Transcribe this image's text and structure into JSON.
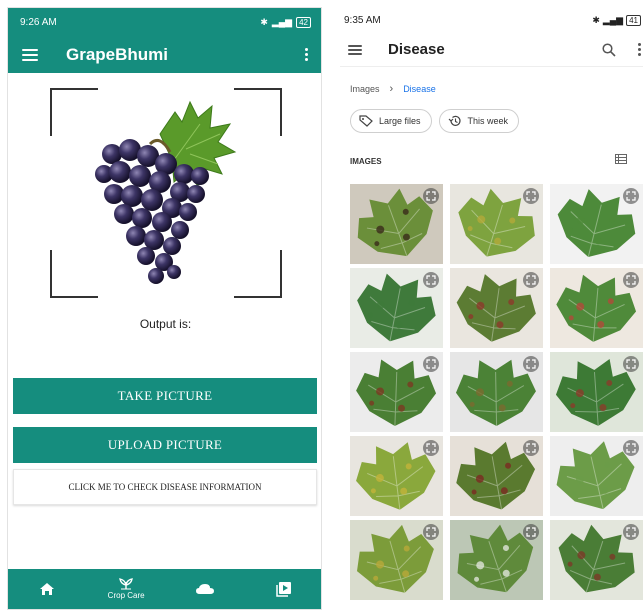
{
  "left_app": {
    "status_time": "9:26 AM",
    "status_battery": "42",
    "title": "GrapeBhumi",
    "output_label": "Output is:",
    "take_picture": "TAKE PICTURE",
    "upload_picture": "UPLOAD PICTURE",
    "check_info": "CLICK ME TO CHECK DISEASE INFORMATION",
    "nav": [
      {
        "label": "",
        "icon": "home-icon"
      },
      {
        "label": "Crop Care",
        "icon": "sprout-icon"
      },
      {
        "label": "",
        "icon": "cloud-icon"
      },
      {
        "label": "",
        "icon": "video-library-icon"
      }
    ],
    "accent": "#158d7e"
  },
  "right_app": {
    "status_time": "9:35 AM",
    "status_battery": "41",
    "title": "Disease",
    "breadcrumb": [
      "Images",
      "Disease"
    ],
    "chips": [
      "Large files",
      "This week"
    ],
    "section_label": "IMAGES",
    "thumbnails": [
      {
        "alt": "leaf-1",
        "leaf": "#6b8f3a",
        "bg": "#cfc9bd",
        "spot": "#3a2a1a"
      },
      {
        "alt": "leaf-2",
        "leaf": "#7ea33f",
        "bg": "#e8e6df",
        "spot": "#b3a93a"
      },
      {
        "alt": "leaf-3",
        "leaf": "#4d8a3a",
        "bg": "#f2f2f2",
        "spot": "#4d8a3a"
      },
      {
        "alt": "leaf-4",
        "leaf": "#3f7a3b",
        "bg": "#e9ece6",
        "spot": "#3f7a3b"
      },
      {
        "alt": "leaf-5",
        "leaf": "#5c7c33",
        "bg": "#eae6df",
        "spot": "#8c3a2a"
      },
      {
        "alt": "leaf-6",
        "leaf": "#4f8a3a",
        "bg": "#eee8e0",
        "spot": "#b04a3a"
      },
      {
        "alt": "leaf-7",
        "leaf": "#4a7f34",
        "bg": "#ececec",
        "spot": "#7a3a22"
      },
      {
        "alt": "leaf-8",
        "leaf": "#4b8236",
        "bg": "#e6e6e6",
        "spot": "#7a6a30"
      },
      {
        "alt": "leaf-9",
        "leaf": "#3d7a35",
        "bg": "#dfe6da",
        "spot": "#8a3c2a"
      },
      {
        "alt": "leaf-10",
        "leaf": "#8aa83c",
        "bg": "#e8e5df",
        "spot": "#c2b33a"
      },
      {
        "alt": "leaf-11",
        "leaf": "#5a7a2f",
        "bg": "#e6e0d8",
        "spot": "#7a2a22"
      },
      {
        "alt": "leaf-12",
        "leaf": "#6c9c48",
        "bg": "#eeeeee",
        "spot": "#6c9c48"
      },
      {
        "alt": "leaf-13",
        "leaf": "#7c9c3a",
        "bg": "#d9dccd",
        "spot": "#b8a93a"
      },
      {
        "alt": "leaf-14",
        "leaf": "#5f8a3b",
        "bg": "#bcc7b5",
        "spot": "#dfe3da"
      },
      {
        "alt": "leaf-15",
        "leaf": "#4a7d36",
        "bg": "#e3e6dc",
        "spot": "#7a3a28"
      }
    ]
  }
}
